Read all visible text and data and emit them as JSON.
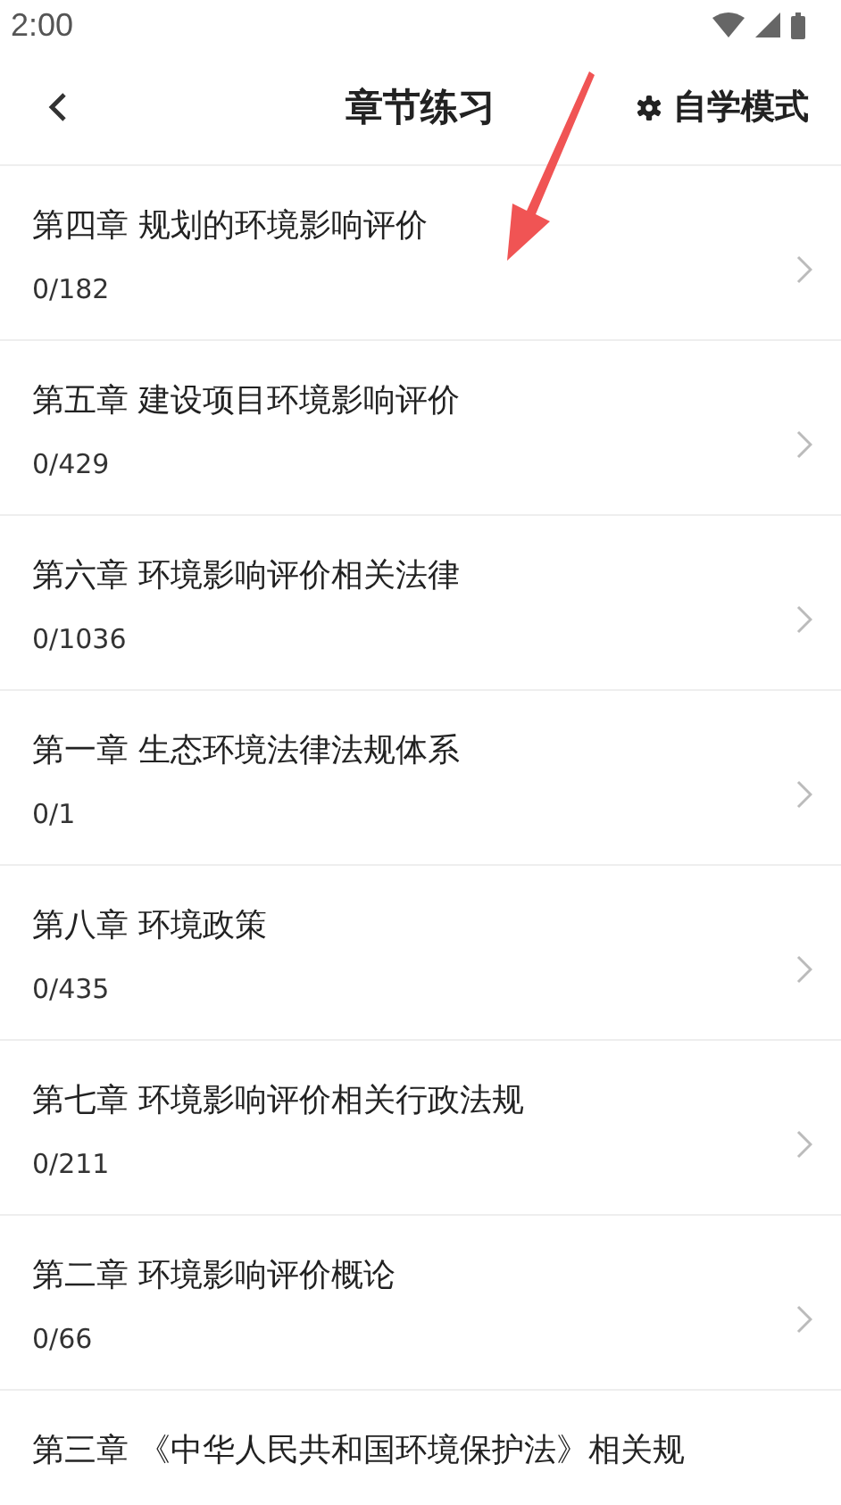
{
  "status_bar": {
    "time": "2:00"
  },
  "header": {
    "title": "章节练习",
    "action": "自学模式"
  },
  "chapters": [
    {
      "title": "第四章 规划的环境影响评价",
      "count": "0/182"
    },
    {
      "title": "第五章 建设项目环境影响评价",
      "count": "0/429"
    },
    {
      "title": "第六章 环境影响评价相关法律",
      "count": "0/1036"
    },
    {
      "title": "第一章 生态环境法律法规体系",
      "count": "0/1"
    },
    {
      "title": "第八章 环境政策",
      "count": "0/435"
    },
    {
      "title": "第七章 环境影响评价相关行政法规",
      "count": "0/211"
    },
    {
      "title": "第二章 环境影响评价概论",
      "count": "0/66"
    },
    {
      "title": "第三章 《中华人民共和国环境保护法》相关规"
    }
  ]
}
